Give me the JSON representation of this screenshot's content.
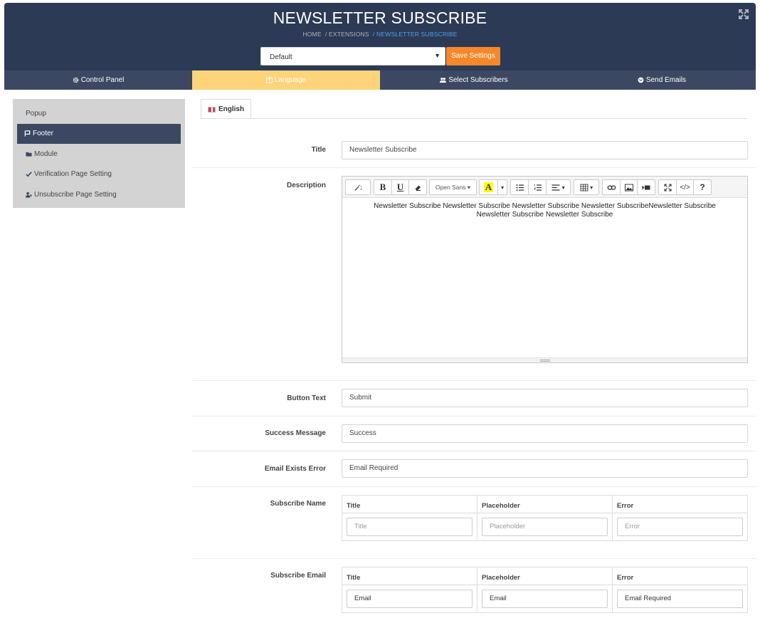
{
  "header": {
    "title": "NEWSLETTER SUBSCRIBE",
    "breadcrumb": [
      "HOME",
      "/ EXTENSIONS",
      "/ NEWSLETTER SUBSCRIBE"
    ],
    "store_select": "Default",
    "save_label": "Save Settings"
  },
  "tabs": [
    {
      "label": "Control Panel",
      "icon": "gear-icon"
    },
    {
      "label": "Language",
      "icon": "language-icon",
      "active": true
    },
    {
      "label": "Select Subscribers",
      "icon": "users-icon"
    },
    {
      "label": "Send Emails",
      "icon": "envelope-icon"
    }
  ],
  "sidebar": {
    "items": [
      {
        "label": "Popup",
        "icon": ""
      },
      {
        "label": "Footer",
        "icon": "flag-icon",
        "active": true
      },
      {
        "label": "Module",
        "icon": "folder-icon"
      },
      {
        "label": "Verification Page Setting",
        "icon": "check-icon"
      },
      {
        "label": "Unsubscribe Page Setting",
        "icon": "user-remove-icon"
      }
    ]
  },
  "language_tab": {
    "label": "English",
    "icon": "uk-flag-icon"
  },
  "form": {
    "title_label": "Title",
    "title_value": "Newsletter Subscribe",
    "description_label": "Description",
    "description_value": "Newsletter Subscribe Newsletter Subscribe Newsletter Subscribe Newsletter SubscribeNewsletter Subscribe Newsletter Subscribe Newsletter Subscribe",
    "font_name": "Open Sans",
    "button_text_label": "Button Text",
    "button_text_value": "Submit",
    "success_label": "Success Message",
    "success_value": "Success",
    "email_exists_label": "Email Exists Error",
    "email_exists_value": "Email Required",
    "subscribe_name": {
      "label": "Subscribe Name",
      "headers": [
        "Title",
        "Placeholder",
        "Error"
      ],
      "placeholders": [
        "Title",
        "Placeholder",
        "Error"
      ]
    },
    "subscribe_email": {
      "label": "Subscribe Email",
      "headers": [
        "Title",
        "Placeholder",
        "Error"
      ],
      "values": [
        "Email",
        "Email",
        "Email Required"
      ]
    }
  }
}
